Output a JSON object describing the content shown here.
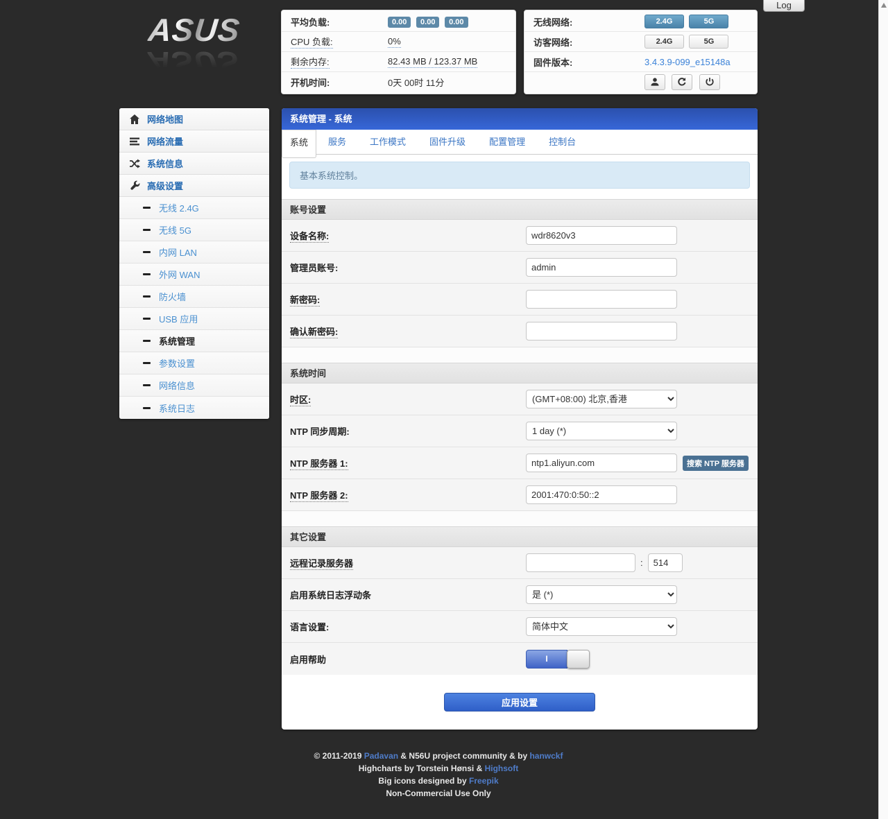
{
  "log_button": "Log",
  "brand": "ASUS",
  "status_panel": {
    "load_label": "平均负载:",
    "load_badges": [
      "0.00",
      "0.00",
      "0.00"
    ],
    "cpu_label": "CPU 负载:",
    "cpu_value": "0%",
    "memory_label": "剩余内存:",
    "memory_value": "82.43 MB / 123.37 MB",
    "uptime_label": "开机时间:",
    "uptime_value": "0天 00时 11分"
  },
  "wireless_panel": {
    "wifi_label": "无线网络:",
    "wifi_24g": "2.4G",
    "wifi_5g": "5G",
    "guest_label": "访客网络:",
    "guest_24g": "2.4G",
    "guest_5g": "5G",
    "firmware_label": "固件版本:",
    "firmware_version": "3.4.3.9-099_e15148a"
  },
  "sidebar": {
    "items": [
      {
        "label": "网络地图"
      },
      {
        "label": "网络流量"
      },
      {
        "label": "系统信息"
      },
      {
        "label": "高级设置"
      }
    ],
    "subitems": [
      {
        "label": "无线 2.4G"
      },
      {
        "label": "无线 5G"
      },
      {
        "label": "内网 LAN"
      },
      {
        "label": "外网 WAN"
      },
      {
        "label": "防火墙"
      },
      {
        "label": "USB 应用"
      },
      {
        "label": "系统管理"
      },
      {
        "label": "参数设置"
      },
      {
        "label": "网络信息"
      },
      {
        "label": "系统日志"
      }
    ]
  },
  "main": {
    "title": "系统管理 - 系统",
    "tabs": [
      "系统",
      "服务",
      "工作模式",
      "固件升级",
      "配置管理",
      "控制台"
    ],
    "alert": "基本系统控制。",
    "account_section": {
      "title": "账号设置",
      "device_name_label": "设备名称:",
      "device_name_value": "wdr8620v3",
      "admin_label": "管理员账号:",
      "admin_value": "admin",
      "new_password_label": "新密码:",
      "new_password_value": "",
      "confirm_password_label": "确认新密码:",
      "confirm_password_value": ""
    },
    "time_section": {
      "title": "系统时间",
      "timezone_label": "时区:",
      "timezone_value": "(GMT+08:00) 北京,香港",
      "ntp_period_label": "NTP 同步周期:",
      "ntp_period_value": "1 day (*)",
      "ntp1_label": "NTP 服务器 1:",
      "ntp1_value": "ntp1.aliyun.com",
      "ntp_search_button": "搜索 NTP 服务器",
      "ntp2_label": "NTP 服务器 2:",
      "ntp2_value": "2001:470:0:50::2"
    },
    "other_section": {
      "title": "其它设置",
      "remote_log_label": "远程记录服务器",
      "remote_log_value": "",
      "remote_log_colon": ":",
      "remote_log_port": "514",
      "syslog_float_label": "启用系统日志浮动条",
      "syslog_float_value": "是 (*)",
      "language_label": "语言设置:",
      "language_value": "简体中文",
      "help_label": "启用帮助",
      "toggle_marker": "I"
    },
    "apply_button": "应用设置"
  },
  "footer": {
    "line1_prefix": "© 2011-2019 ",
    "line1_link1": "Padavan",
    "line1_mid": " & N56U project community & by ",
    "line1_link2": "hanwckf",
    "line2_prefix": "Highcharts by Torstein Hønsi & ",
    "line2_link": "Highsoft",
    "line3_prefix": "Big icons designed by ",
    "line3_link": "Freepik",
    "line4": "Non-Commercial Use Only"
  }
}
